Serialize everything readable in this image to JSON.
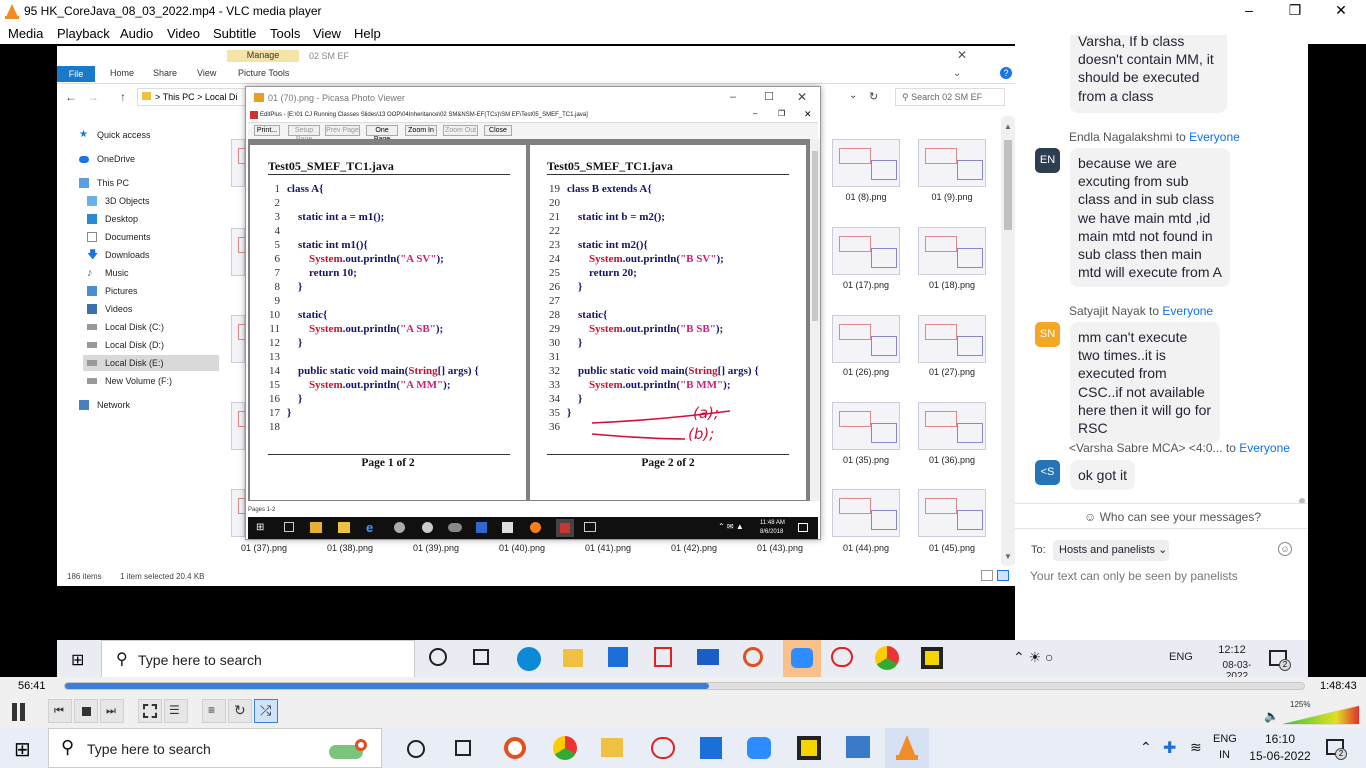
{
  "vlc": {
    "title": "95 HK_CoreJava_08_03_2022.mp4 - VLC media player",
    "menu": [
      "Media",
      "Playback",
      "Audio",
      "Video",
      "Subtitle",
      "Tools",
      "View",
      "Help"
    ],
    "time_elapsed": "56:41",
    "time_total": "1:48:43",
    "progress": 0.52,
    "volume_label": "125%",
    "volume": 1.25
  },
  "explorer": {
    "manage_tab": "Manage",
    "folder_title": "02 SM EF",
    "tabs": [
      "File",
      "Home",
      "Share",
      "View",
      "Picture Tools"
    ],
    "breadcrumb": [
      "This PC",
      "Local Di"
    ],
    "search_placeholder": "Search 02 SM EF",
    "nav": [
      "Quick access",
      "OneDrive",
      "This PC",
      "3D Objects",
      "Desktop",
      "Documents",
      "Downloads",
      "Music",
      "Pictures",
      "Videos",
      "Local Disk (C:)",
      "Local Disk (D:)",
      "Local Disk (E:)",
      "New Volume (F:)",
      "Network"
    ],
    "thumbs_right": [
      [
        "01 (8).png",
        "01 (9).png"
      ],
      [
        "01 (17).png",
        "01 (18).png"
      ],
      [
        "01 (26).png",
        "01 (27).png"
      ],
      [
        "01 (35).png",
        "01 (36).png"
      ],
      [
        "01 (44).png",
        "01 (45).png"
      ]
    ],
    "thumbs_bottom": [
      "01 (37).png",
      "01 (38).png",
      "01 (39).png",
      "01 (40).png",
      "01 (41).png",
      "01 (42).png",
      "01 (43).png"
    ],
    "status_items": "186 items",
    "status_selected": "1 item selected  20.4 KB"
  },
  "picasa": {
    "title": "01 (70).png - Picasa Photo Viewer",
    "editplus_path": "EditPlus - [E:\\01 CJ Running Classes Slides\\13 OOP\\04Inheritance\\02 SM&NSM-EF(TCs)\\SM EF\\Test05_SMEF_TC1.java]",
    "buttons": [
      "Print...",
      "Setup Page",
      "Prev Page",
      "One Page",
      "Zoom In",
      "Zoom Out",
      "Close"
    ],
    "file_title_1": "Test05_SMEF_TC1.java",
    "file_title_2": "Test05_SMEF_TC1.java",
    "page1_label": "Page 1 of 2",
    "page2_label": "Page 2 of 2",
    "pages_status": "Pages 1-2",
    "inner_clock": "11:48 AM",
    "inner_date": "8/6/2018",
    "page1_lines": [
      [
        "1",
        "class A{"
      ],
      [
        "2",
        ""
      ],
      [
        "3",
        "    static int a = m1();"
      ],
      [
        "4",
        ""
      ],
      [
        "5",
        "    static int m1(){"
      ],
      [
        "6",
        "        System.out.println(\"A SV\");"
      ],
      [
        "7",
        "        return 10;"
      ],
      [
        "8",
        "    }"
      ],
      [
        "9",
        ""
      ],
      [
        "10",
        "    static{"
      ],
      [
        "11",
        "        System.out.println(\"A SB\");"
      ],
      [
        "12",
        "    }"
      ],
      [
        "13",
        ""
      ],
      [
        "14",
        "    public static void main(String[] args) {"
      ],
      [
        "15",
        "        System.out.println(\"A MM\");"
      ],
      [
        "16",
        "    }"
      ],
      [
        "17",
        "}"
      ],
      [
        "18",
        ""
      ]
    ],
    "page2_lines": [
      [
        "19",
        "class B extends A{"
      ],
      [
        "20",
        ""
      ],
      [
        "21",
        "    static int b = m2();"
      ],
      [
        "22",
        ""
      ],
      [
        "23",
        "    static int m2(){"
      ],
      [
        "24",
        "        System.out.println(\"B SV\");"
      ],
      [
        "25",
        "        return 20;"
      ],
      [
        "26",
        "    }"
      ],
      [
        "27",
        ""
      ],
      [
        "28",
        "    static{"
      ],
      [
        "29",
        "        System.out.println(\"B SB\");"
      ],
      [
        "30",
        "    }"
      ],
      [
        "31",
        ""
      ],
      [
        "32",
        "    public static void main(String[] args) {"
      ],
      [
        "33",
        "        System.out.println(\"B MM\");"
      ],
      [
        "34",
        "    }"
      ],
      [
        "35",
        "}"
      ],
      [
        "36",
        ""
      ]
    ],
    "annotation_a": "(a);",
    "annotation_b": "(b);"
  },
  "chat": {
    "partial_message": "Varsha, If b class doesn't contain MM, it should be executed from a class",
    "messages": [
      {
        "from": "Endla Nagalakshmi",
        "to": "Everyone",
        "initials": "EN",
        "color": "#2d3e50",
        "text": "because we are excuting from sub class and in sub class we have main mtd ,id main mtd not found in sub class then main mtd will execute from A"
      },
      {
        "from": "Satyajit Nayak",
        "to": "Everyone",
        "initials": "SN",
        "color": "#f5a623",
        "text": "mm can't execute two times..it is executed from CSC..if not available here then it will go for RSC"
      },
      {
        "from": "<Varsha Sabre MCA> <4:0...",
        "to": "Everyone",
        "initials": "<S",
        "color": "#2574b8",
        "text": "ok got it"
      }
    ],
    "to_word": "to",
    "who_can_see": "Who can see your messages?",
    "to_label": "To:",
    "recipient": "Hosts and panelists",
    "input_placeholder": "Your text can only be seen by panelists"
  },
  "inner_taskbar": {
    "search_placeholder": "Type here to search",
    "lang": "ENG",
    "time": "12:12",
    "date": "08-03-2022",
    "notif_count": "2"
  },
  "taskbar": {
    "search_placeholder": "Type here to search",
    "lang_line1": "ENG",
    "lang_line2": "IN",
    "time": "16:10",
    "date": "15-06-2022",
    "notif_count": "2"
  },
  "colors": {
    "vlc_orange": "#f28c28",
    "progress_blue": "#3b7fd8",
    "zoom_blue": "#0e71eb"
  }
}
